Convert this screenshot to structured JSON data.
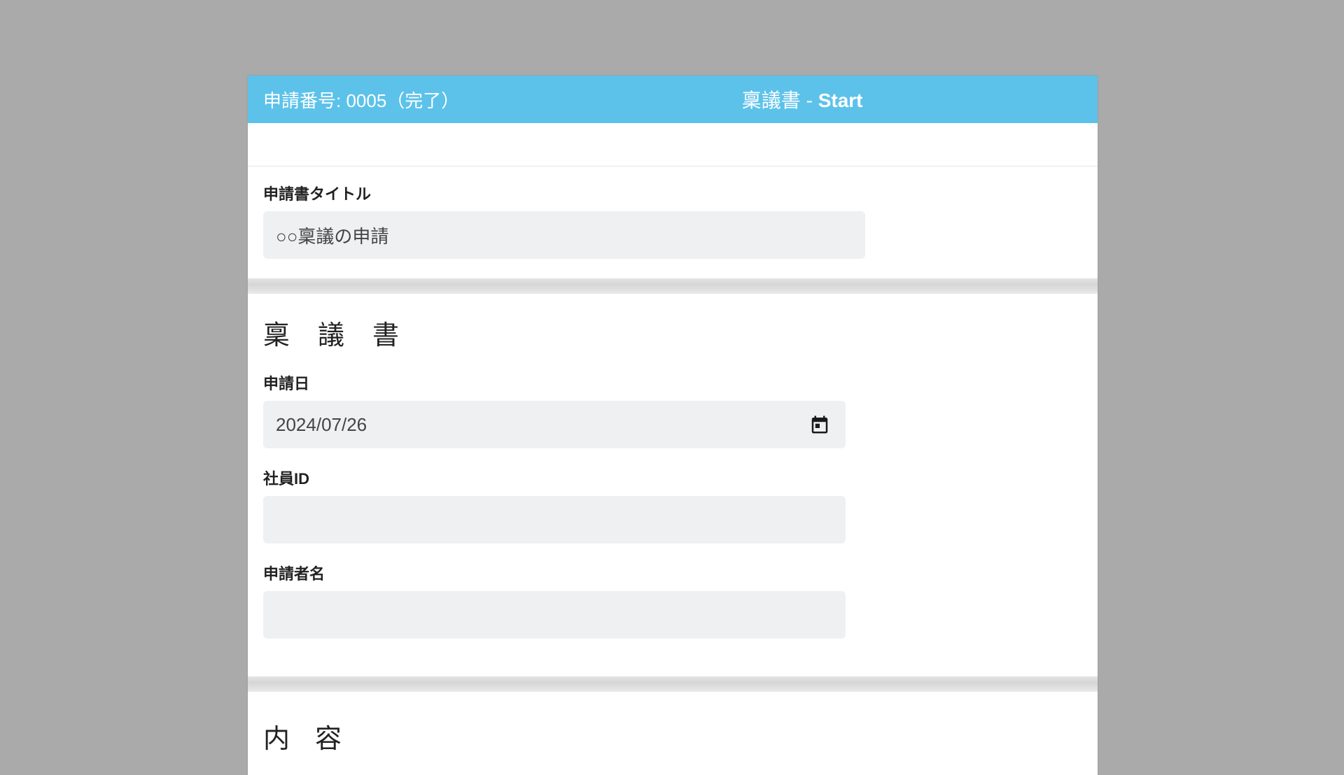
{
  "header": {
    "application_number_label": "申請番号: 0005（完了）",
    "title_prefix": "稟議書 - ",
    "title_bold": "Start"
  },
  "section_title_form": {
    "label": "申請書タイトル",
    "value": "○○稟議の申請"
  },
  "ringi": {
    "heading": "稟議書",
    "fields": {
      "application_date": {
        "label": "申請日",
        "value": "2024/07/26"
      },
      "employee_id": {
        "label": "社員ID",
        "value": ""
      },
      "applicant_name": {
        "label": "申請者名",
        "value": ""
      }
    }
  },
  "content": {
    "heading": "内容"
  }
}
